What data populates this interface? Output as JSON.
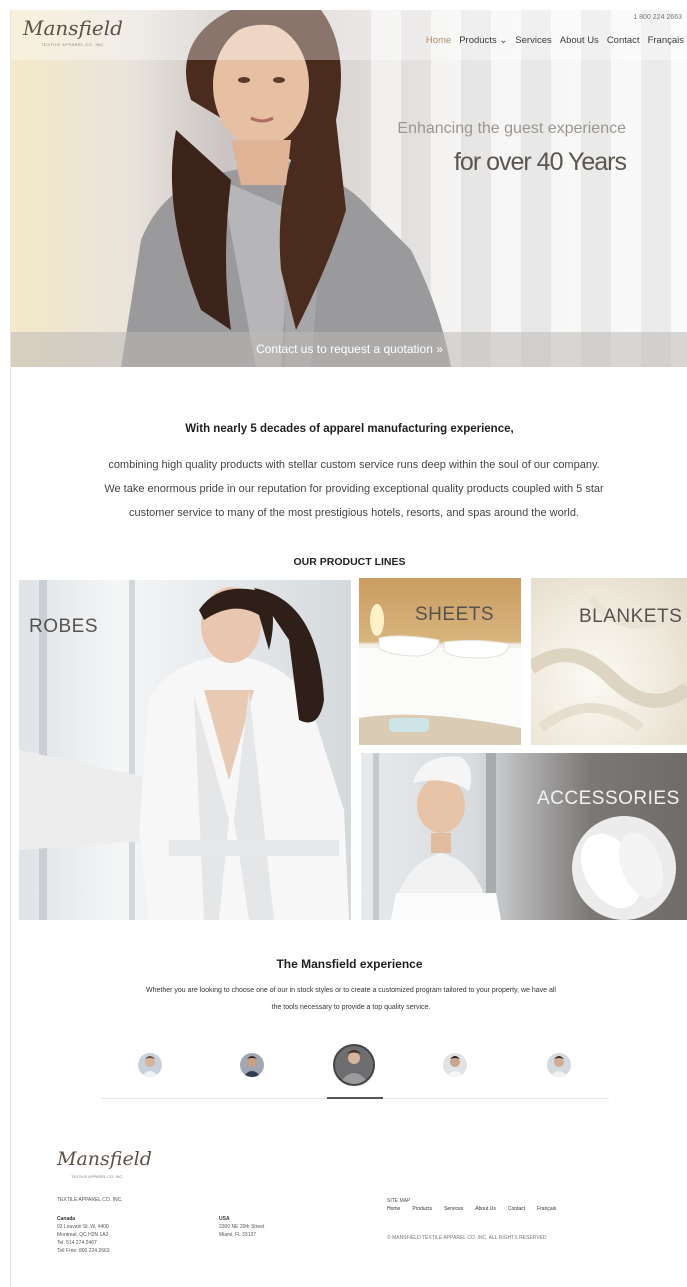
{
  "brand": {
    "name": "Mansfield",
    "tagline": "TEXTILE APPAREL CO. INC.",
    "phone": "1 800 224 2663"
  },
  "nav": {
    "items": [
      {
        "label": "Home",
        "active": true
      },
      {
        "label": "Products ⌄",
        "active": false
      },
      {
        "label": "Services",
        "active": false
      },
      {
        "label": "About Us",
        "active": false
      },
      {
        "label": "Contact",
        "active": false
      },
      {
        "label": "Français",
        "active": false
      }
    ],
    "active_color": "#b28c6a"
  },
  "hero": {
    "tagline_line1": "Enhancing the guest experience",
    "tagline_line2": "for over 40 Years",
    "cta": "Contact us to request a quotation »"
  },
  "intro": {
    "heading": "With nearly 5 decades of apparel manufacturing experience,",
    "lines": [
      "combining high quality products with stellar custom service runs deep within the soul of our company.",
      "We take enormous pride in our reputation for providing exceptional quality products coupled with 5 star",
      "customer service to many of the most prestigious hotels, resorts, and spas around the world."
    ]
  },
  "product_lines": {
    "heading": "OUR PRODUCT LINES",
    "items": [
      {
        "label": "ROBES"
      },
      {
        "label": "SHEETS"
      },
      {
        "label": "BLANKETS"
      },
      {
        "label": "ACCESSORIES"
      }
    ]
  },
  "experience": {
    "heading": "The Mansfield experience",
    "text": "Whether you are looking to choose one of our in stock styles or to create a customized program tailored to your property, we have all the tools necessary to provide a top quality service.",
    "active_index": 2
  },
  "footer": {
    "company": "TEXTILE APPAREL CO. INC.",
    "canada_title": "Canada",
    "canada_lines": [
      "93 Louvain St. W, #400",
      "Montreal, QC H2N 1A3",
      "Tel: 514 274 2467",
      "Toll Free: 800 224 2663"
    ],
    "usa_title": "USA",
    "usa_lines": [
      "2300 NE 20th Street",
      "Miami, FL 33137"
    ],
    "site_map_label": "SITE MAP",
    "menu": [
      "Home",
      "Products",
      "Services",
      "About Us",
      "Contact",
      "Français"
    ],
    "rights": "© MANSFIELD TEXTILE APPAREL CO. INC. ALL RIGHTS RESERVED"
  }
}
